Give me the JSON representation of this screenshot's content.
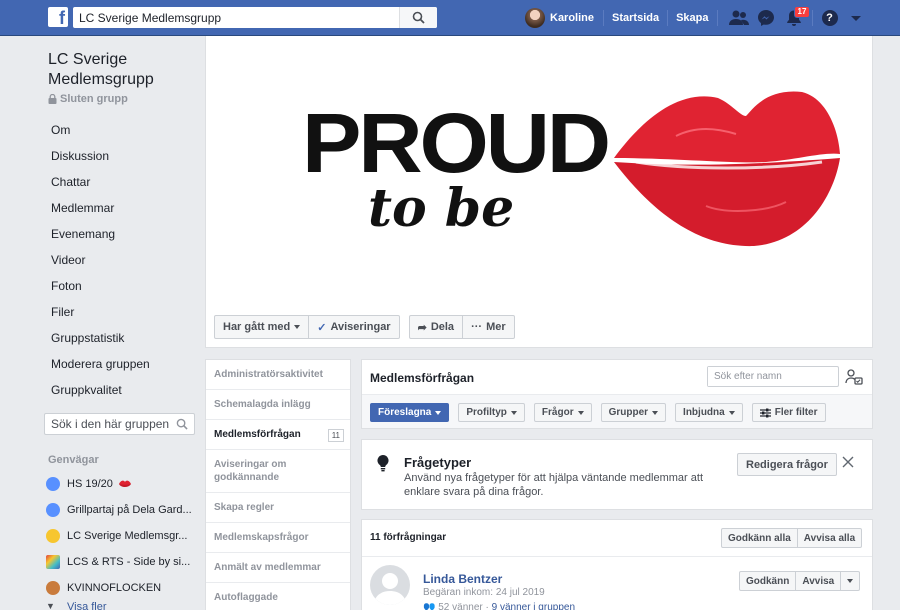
{
  "topbar": {
    "logo": "f",
    "search_value": "LC Sverige Medlemsgrupp",
    "user_name": "Karoline",
    "home": "Startsida",
    "create": "Skapa",
    "notifications_count": "17",
    "help": "?"
  },
  "group": {
    "name": "LC Sverige Medlemsgrupp",
    "type": "Sluten grupp"
  },
  "sidebar": {
    "nav": [
      "Om",
      "Diskussion",
      "Chattar",
      "Medlemmar",
      "Evenemang",
      "Videor",
      "Foton",
      "Filer",
      "Gruppstatistik",
      "Moderera gruppen",
      "Gruppkvalitet"
    ],
    "search_placeholder": "Sök i den här gruppen",
    "shortcuts_heading": "Genvägar",
    "shortcuts": [
      {
        "label": "HS 19/20",
        "color": "#5890ff"
      },
      {
        "label": "Grillpartaj på Dela Gard...",
        "color": "#5890ff"
      },
      {
        "label": "LC Sverige Medlemsgr...",
        "color": "#f7c62f"
      },
      {
        "label": "LCS & RTS - Side by si...",
        "color": "#44bec7"
      },
      {
        "label": "KVINNOFLOCKEN",
        "color": "#c97b3c"
      }
    ],
    "see_more": "Visa fler"
  },
  "cover": {
    "headline": "PROUD",
    "subline": "to be",
    "accent": "#e02332"
  },
  "cover_actions": {
    "joined": "Har gått med",
    "notifications": "Aviseringar",
    "share": "Dela",
    "more": "Mer"
  },
  "admin_nav": [
    {
      "label": "Administratörsaktivitet",
      "active": false
    },
    {
      "label": "Schemalagda inlägg",
      "active": false
    },
    {
      "label": "Medlemsförfrågan",
      "active": true,
      "count": "11"
    },
    {
      "label": "Aviseringar om godkännande",
      "active": false
    },
    {
      "label": "Skapa regler",
      "active": false
    },
    {
      "label": "Medlemskapsfrågor",
      "active": false
    },
    {
      "label": "Anmält av medlemmar",
      "active": false
    },
    {
      "label": "Autoflaggade",
      "active": false
    }
  ],
  "requests_panel": {
    "title": "Medlemsförfrågan",
    "search_placeholder": "Sök efter namn",
    "filters": [
      "Föreslagna",
      "Profiltyp",
      "Frågor",
      "Grupper",
      "Inbjudna"
    ],
    "more_filters": "Fler filter"
  },
  "tip": {
    "title": "Frågetyper",
    "body": "Använd nya frågetyper för att hjälpa väntande medlemmar att enklare svara på dina frågor.",
    "button": "Redigera frågor"
  },
  "requests": {
    "count_label": "11 förfrågningar",
    "approve_all": "Godkänn alla",
    "decline_all": "Avvisa alla",
    "items": [
      {
        "name": "Linda Bentzer",
        "requested": "Begäran inkom: 24 jul 2019",
        "friends": "52 vänner",
        "friends_in_group": "9 vänner i gruppen",
        "approve": "Godkänn",
        "decline": "Avvisa"
      }
    ]
  }
}
